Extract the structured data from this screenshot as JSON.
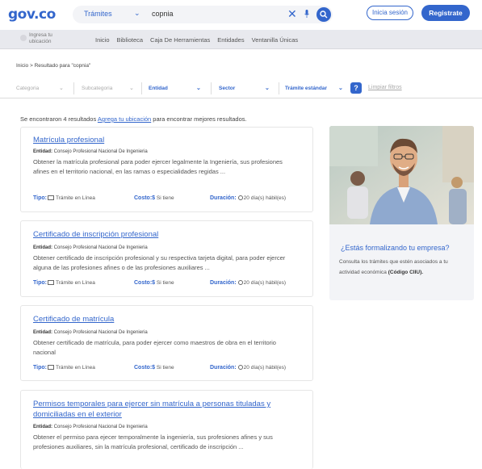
{
  "header": {
    "logo": "gov.co",
    "search_category": "Trámites",
    "search_query": "copnia",
    "login_label": "Inicia sesión",
    "register_label": "Registrate"
  },
  "navbar": {
    "location_label": "Ingresa tu ubicación",
    "items": [
      "Inicio",
      "Biblioteca",
      "Caja De Herramientas",
      "Entidades",
      "Ventanilla Únicas"
    ]
  },
  "breadcrumb": "Inicio > Resultado para \"copnia\"",
  "filters": {
    "categoria": "Categoria",
    "subcategoria": "Subcategoria",
    "entidad": "Entidad",
    "sector": "Sector",
    "tramite": "Trámite estándar",
    "help": "?",
    "clear": "Limpiar filtros"
  },
  "results": {
    "count_prefix": "Se encontraron 4 resultados",
    "count_link": "Agrega tu ubicación",
    "count_suffix": "para encontrar mejores resultados.",
    "items": [
      {
        "title": "Matrícula profesional",
        "entity_label": "Entidad:",
        "entity": "Consejo Profesional Nacional De Ingenieria",
        "description": "Obtener la matrícula profesional para poder ejercer legalmente la Ingeniería, sus profesiones afines en el territorio nacional, en las ramas o especialidades regidas ...",
        "tipo_label": "Tipo:",
        "tipo": "Trámite en Línea",
        "costo_label": "Costo:",
        "costo": "Si tiene",
        "duracion_label": "Duración:",
        "duracion": "20 día(s) hábil(es)"
      },
      {
        "title": "Certificado de inscripción profesional",
        "entity_label": "Entidad:",
        "entity": "Consejo Profesional Nacional De Ingenieria",
        "description": "Obtener certificado de inscripción profesional y su respectiva tarjeta digital, para poder ejercer alguna de las profesiones afines o de las profesiones auxiliares ...",
        "tipo_label": "Tipo:",
        "tipo": "Trámite en Línea",
        "costo_label": "Costo:",
        "costo": "Si tiene",
        "duracion_label": "Duración:",
        "duracion": "20 día(s) hábil(es)"
      },
      {
        "title": "Certificado de matrícula",
        "entity_label": "Entidad:",
        "entity": "Consejo Profesional Nacional De Ingenieria",
        "description": "Obtener certificado de matrícula, para poder ejercer como maestros de obra en el territorio nacional",
        "tipo_label": "Tipo:",
        "tipo": "Trámite en Línea",
        "costo_label": "Costo:",
        "costo": "Si tiene",
        "duracion_label": "Duración:",
        "duracion": "20 día(s) hábil(es)"
      },
      {
        "title": "Permisos temporales para ejercer sin matrícula a personas tituladas y domiciliadas en el exterior",
        "entity_label": "Entidad:",
        "entity": "Consejo Profesional Nacional De Ingenieria",
        "description": "Obtener el permiso para ejecer temporalmente la ingeniería, sus profesiones afines y sus profesiones auxiliares, sin la matrícula profesional, certificado de inscripción ..."
      }
    ]
  },
  "promo": {
    "title": "¿Estás formalizando tu empresa?",
    "text": "Consulta los trámites que estén asociados a tu actividad económica",
    "text_bold": "(Código CIIU)."
  },
  "colors": {
    "brand_blue": "#3366cc",
    "nav_gray": "#e8e9ee"
  }
}
